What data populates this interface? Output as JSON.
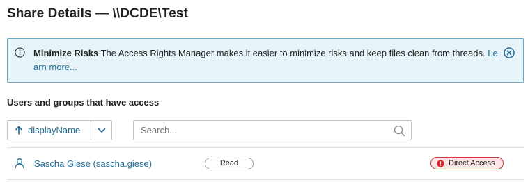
{
  "page": {
    "title": "Share Details — \\\\DCDE\\Test"
  },
  "banner": {
    "title": "Minimize Risks",
    "message": "The Access Rights Manager makes it easier to minimize risks and keep files clean from threads.",
    "link_label": "Learn more...",
    "icon": "info-icon",
    "close_icon": "close-circle-icon",
    "colors": {
      "background": "#e6f3f8",
      "border": "#64aac6",
      "accent": "#1f6d98"
    }
  },
  "section": {
    "title": "Users and groups that have access"
  },
  "sort": {
    "field_label": "displayName",
    "direction_icon": "arrow-up-icon",
    "dropdown_icon": "chevron-down-icon"
  },
  "search": {
    "placeholder": "Search...",
    "value": "",
    "icon": "search-icon"
  },
  "access_list": [
    {
      "name": "Sascha Giese (sascha.giese)",
      "icon": "user-icon",
      "permission": "Read",
      "access_type": "Direct Access",
      "access_icon": "alert-icon",
      "access_color": "#d0242a"
    }
  ]
}
